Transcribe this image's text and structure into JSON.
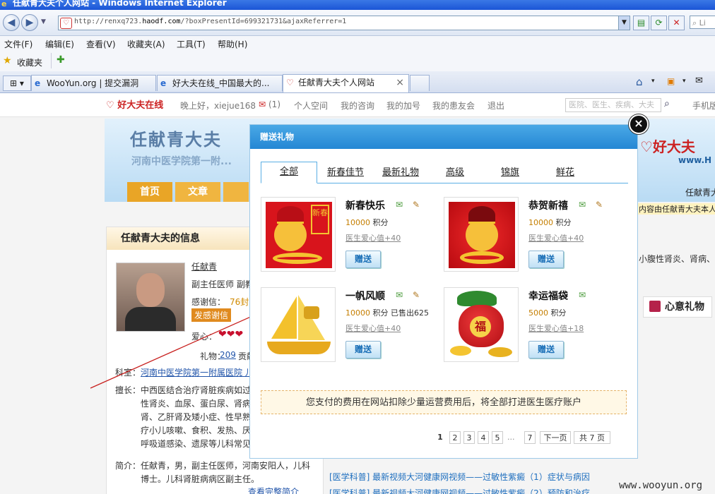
{
  "window": {
    "title": "任献青大夫个人网站 - Windows Internet Explorer"
  },
  "address_bar": {
    "url_prefix": "http://renxq723.",
    "url_domain": "haodf.com",
    "url_suffix": "/?boxPresentId=699321731&ajaxReferrer=1",
    "search_placeholder": "Li"
  },
  "menu": [
    "文件(F)",
    "编辑(E)",
    "查看(V)",
    "收藏夹(A)",
    "工具(T)",
    "帮助(H)"
  ],
  "favorites_label": "收藏夹",
  "tabs": [
    {
      "label": "WooYun.org | 提交漏洞"
    },
    {
      "label": "好大夫在线_中国最大的..."
    },
    {
      "label": "任献青大夫个人网站",
      "close": "×"
    }
  ],
  "site": {
    "logo": "好大夫在线",
    "greeting": "晚上好，xiejue168",
    "message_count": "(1)",
    "links": [
      "个人空间",
      "我的咨询",
      "我的加号",
      "我的患友会",
      "退出"
    ],
    "search_placeholder": "医院、医生、疾病、大夫",
    "right_link": "手机版"
  },
  "doctor": {
    "name_title": "任献青大夫",
    "hospital_line": "河南中医学院第一附...",
    "nav_home": "首页",
    "nav_article": "文章",
    "info_header": "任献青大夫的信息",
    "name": "任献青",
    "rank": "副主任医师 副教",
    "thanks_label": "感谢信：",
    "thanks_count": "76封",
    "send_thanks": "发感谢信",
    "heart_label": "爱心：",
    "gift_label": "礼物：",
    "gift_count": "209",
    "contribution": "贡献值",
    "department_label": "科室：",
    "department": "河南中医学院第一附属医院 儿",
    "specialty_label": "擅长：",
    "specialty_lines": [
      "中西医结合治疗肾脏疾病如过",
      "性肾炎、血尿、蛋白尿、肾病",
      "肾、乙肝肾及矮小症、性早熟",
      "疗小儿咳嗽、食积、发热、厌",
      "呼吸道感染、遗尿等儿科常见"
    ],
    "intro_label": "简介：",
    "intro_lines": [
      "任献青，男，副主任医师，河南安阳人，儿科",
      "博士。儿科肾脏病病区副主任。"
    ],
    "more_link": "查看完整简介",
    "right_name": "任献青大",
    "right_notice": "内容由任献青大夫本人",
    "right_desc": "小腹性肾炎、肾病、血",
    "gift_button": "心意礼物",
    "bottom_links": [
      "[医学科普] 最新视频大河健康网视频——过敏性紫癜（1）症状与病因",
      "[医学科普] 最新视频大河健康网视频——过敏性紫癜（2）预防和治疗"
    ],
    "banner_brand": "好大夫",
    "banner_url": "www.H"
  },
  "watermark": "www.wooyun.org",
  "modal": {
    "title": "赠送礼物",
    "close": "×",
    "tabs": [
      "全部",
      "新春佳节",
      "最新礼物",
      "高级",
      "锦旗",
      "鲜花"
    ],
    "points_unit": "积分",
    "send_label": "赠送",
    "gifts": [
      {
        "name": "新春快乐",
        "points": "10000",
        "sold": "",
        "love": "医生爱心值+40",
        "img_text": "新春"
      },
      {
        "name": "恭贺新禧",
        "points": "10000",
        "sold": "",
        "love": "医生爱心值+40",
        "img_text": ""
      },
      {
        "name": "一帆风顺",
        "points": "10000",
        "sold": "已售出625",
        "love": "医生爱心值+40",
        "img_text": ""
      },
      {
        "name": "幸运福袋",
        "points": "5000",
        "sold": "",
        "love": "医生爱心值+18",
        "img_text": "福"
      }
    ],
    "notice": "您支付的费用在网站扣除少量运营费用后，将全部打进医生医疗账户",
    "pager": {
      "current": "1",
      "pages": [
        "2",
        "3",
        "4",
        "5"
      ],
      "dots": "...",
      "last": "7",
      "next": "下一页",
      "total": "共 7 页"
    }
  },
  "colors": {
    "accent": "#2487d4",
    "points": "#c47e00",
    "gift_red": "#d8141c"
  }
}
